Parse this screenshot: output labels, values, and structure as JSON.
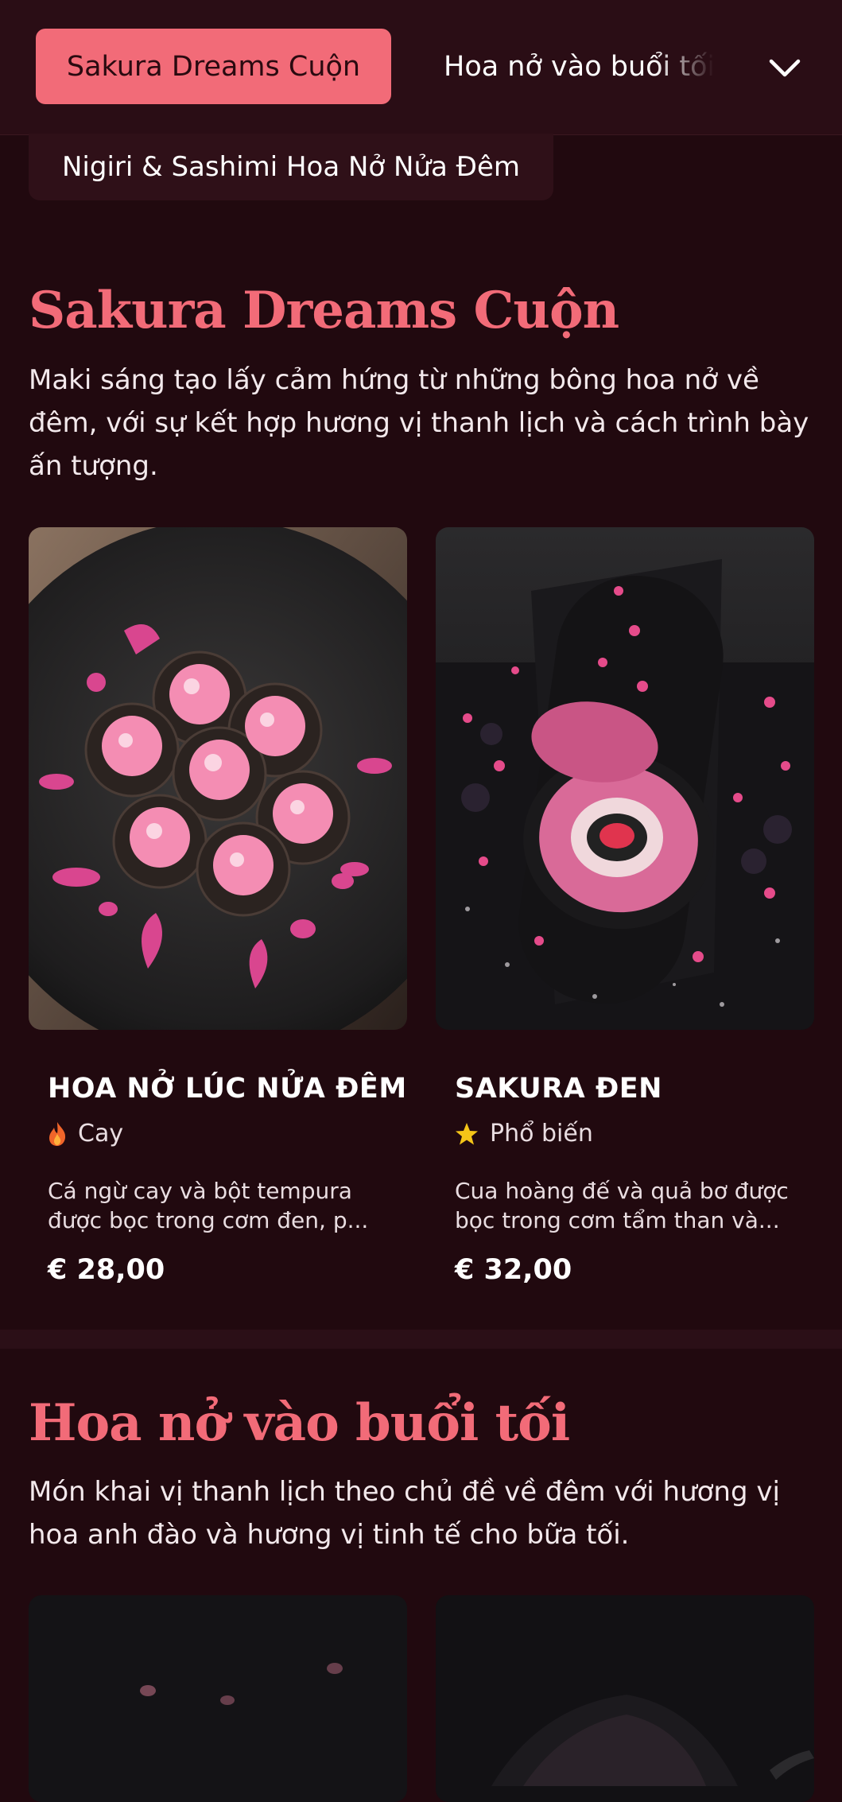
{
  "nav": {
    "active_tab": "Sakura Dreams Cuộn",
    "next_tab": "Hoa nở vào buổi tối",
    "chip": "Nigiri & Sashimi Hoa Nở Nửa Đêm",
    "more_icon": "chevron-down-icon"
  },
  "sections": [
    {
      "title": "Sakura Dreams Cuộn",
      "description": "Maki sáng tạo lấy cảm hứng từ những bông hoa nở về đêm, với sự kết hợp hương vị thanh lịch và cách trình bày ấn tượng.",
      "items": [
        {
          "name": "HOA NỞ LÚC NỬA ĐÊM",
          "tag": "Cay",
          "tag_icon": "flame-icon",
          "description": "Cá ngừ cay và bột tempura được bọc trong cơm đen, p...",
          "price": "€ 28,00"
        },
        {
          "name": "SAKURA ĐEN",
          "tag": "Phổ biến",
          "tag_icon": "star-icon",
          "description": "Cua hoàng đế và quả bơ được bọc trong cơm tẩm than và...",
          "price": "€ 32,00"
        }
      ]
    },
    {
      "title": "Hoa nở vào buổi tối",
      "description": "Món khai vị thanh lịch theo chủ đề về đêm với hương vị hoa anh đào và hương vị tinh tế cho bữa tối."
    }
  ],
  "colors": {
    "background": "#21090f",
    "accent": "#f26b78",
    "flame": "#f0652a",
    "star": "#f5c518"
  }
}
